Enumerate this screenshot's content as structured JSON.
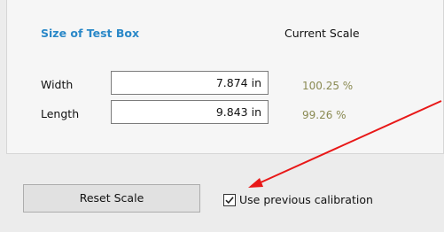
{
  "test_box": {
    "title": "Size of Test Box",
    "scale_header": "Current Scale",
    "rows": [
      {
        "label": "Width",
        "value": "7.874 in",
        "scale": "100.25 %"
      },
      {
        "label": "Length",
        "value": "9.843 in",
        "scale": "99.26 %"
      }
    ]
  },
  "actions": {
    "reset_label": "Reset Scale",
    "checkbox_label": "Use previous calibration",
    "checkbox_checked": true
  },
  "colors": {
    "title": "#2a88c8",
    "scale_text": "#8a8a52",
    "annotation_arrow": "#e81818"
  }
}
